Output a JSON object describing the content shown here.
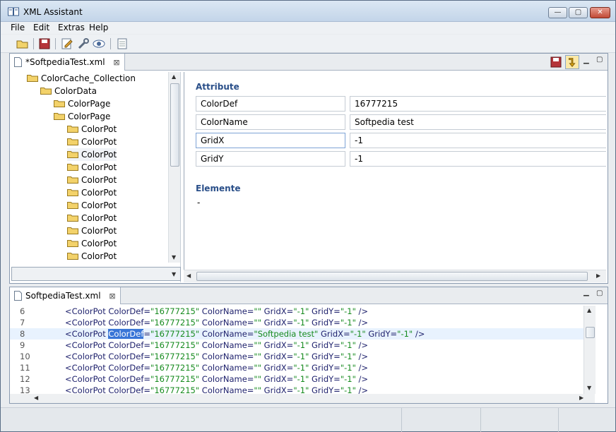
{
  "window": {
    "title": "XML Assistant",
    "min_label": "—",
    "max_label": "▢",
    "close_label": "✕"
  },
  "menu": {
    "items": [
      "File",
      "Edit",
      "Extras",
      "Help"
    ]
  },
  "toolbar": {
    "icons": [
      "open-folder-icon",
      "save-icon",
      "edit-icon",
      "tools-icon",
      "preview-eye-icon",
      "document-icon"
    ]
  },
  "editor": {
    "tab_label": "*SoftpediaTest.xml",
    "close_glyph": "⊠",
    "tree": [
      {
        "label": "ColorCache_Collection",
        "level": 0
      },
      {
        "label": "ColorData",
        "level": 1
      },
      {
        "label": "ColorPage",
        "level": 2
      },
      {
        "label": "ColorPage",
        "level": 2
      },
      {
        "label": "ColorPot",
        "level": 3
      },
      {
        "label": "ColorPot",
        "level": 3
      },
      {
        "label": "ColorPot",
        "level": 3,
        "selected": true
      },
      {
        "label": "ColorPot",
        "level": 3
      },
      {
        "label": "ColorPot",
        "level": 3
      },
      {
        "label": "ColorPot",
        "level": 3
      },
      {
        "label": "ColorPot",
        "level": 3
      },
      {
        "label": "ColorPot",
        "level": 3
      },
      {
        "label": "ColorPot",
        "level": 3
      },
      {
        "label": "ColorPot",
        "level": 3
      },
      {
        "label": "ColorPot",
        "level": 3
      }
    ],
    "attribute_title": "Attribute",
    "attributes": [
      {
        "name": "ColorDef",
        "value": "16777215"
      },
      {
        "name": "ColorName",
        "value": "Softpedia test"
      },
      {
        "name": "GridX",
        "value": "-1"
      },
      {
        "name": "GridY",
        "value": "-1"
      }
    ],
    "elements_title": "Elemente",
    "elements_value": "-"
  },
  "source": {
    "tab_label": "SoftpediaTest.xml",
    "close_glyph": "⊠",
    "lines": [
      {
        "no": "6",
        "pre": "<ColorPot ColorDef=",
        "v1": "\"16777215\"",
        "mid1": " ColorName=",
        "v2": "\"\"",
        "mid2": " GridX=",
        "v3": "\"-1\"",
        "mid3": " GridY=",
        "v4": "\"-1\"",
        "post": " />"
      },
      {
        "no": "7",
        "pre": "<ColorPot ColorDef=",
        "v1": "\"16777215\"",
        "mid1": " ColorName=",
        "v2": "\"\"",
        "mid2": " GridX=",
        "v3": "\"-1\"",
        "mid3": " GridY=",
        "v4": "\"-1\"",
        "post": " />"
      },
      {
        "no": "8",
        "pre": "<ColorPot ",
        "sel": "ColorDef",
        "pre2": "=",
        "v1": "\"16777215\"",
        "mid1": " ColorName=",
        "v2": "\"Softpedia test\"",
        "mid2": " GridX=",
        "v3": "\"-1\"",
        "mid3": " GridY=",
        "v4": "\"-1\"",
        "post": " />",
        "highlight": true
      },
      {
        "no": "9",
        "pre": "<ColorPot ColorDef=",
        "v1": "\"16777215\"",
        "mid1": " ColorName=",
        "v2": "\"\"",
        "mid2": " GridX=",
        "v3": "\"-1\"",
        "mid3": " GridY=",
        "v4": "\"-1\"",
        "post": " />"
      },
      {
        "no": "10",
        "pre": "<ColorPot ColorDef=",
        "v1": "\"16777215\"",
        "mid1": " ColorName=",
        "v2": "\"\"",
        "mid2": " GridX=",
        "v3": "\"-1\"",
        "mid3": " GridY=",
        "v4": "\"-1\"",
        "post": " />"
      },
      {
        "no": "11",
        "pre": "<ColorPot ColorDef=",
        "v1": "\"16777215\"",
        "mid1": " ColorName=",
        "v2": "\"\"",
        "mid2": " GridX=",
        "v3": "\"-1\"",
        "mid3": " GridY=",
        "v4": "\"-1\"",
        "post": " />"
      },
      {
        "no": "12",
        "pre": "<ColorPot ColorDef=",
        "v1": "\"16777215\"",
        "mid1": " ColorName=",
        "v2": "\"\"",
        "mid2": " GridX=",
        "v3": "\"-1\"",
        "mid3": " GridY=",
        "v4": "\"-1\"",
        "post": " />"
      },
      {
        "no": "13",
        "pre": "<ColorPot ColorDef=",
        "v1": "\"16777215\"",
        "mid1": " ColorName=",
        "v2": "\"\"",
        "mid2": " GridX=",
        "v3": "\"-1\"",
        "mid3": " GridY=",
        "v4": "\"-1\"",
        "post": " />"
      }
    ]
  },
  "colors": {
    "accent": "#2a4f89",
    "selection": "#3875d7",
    "string_value": "#178b1f",
    "tag": "#1c1f6b"
  }
}
